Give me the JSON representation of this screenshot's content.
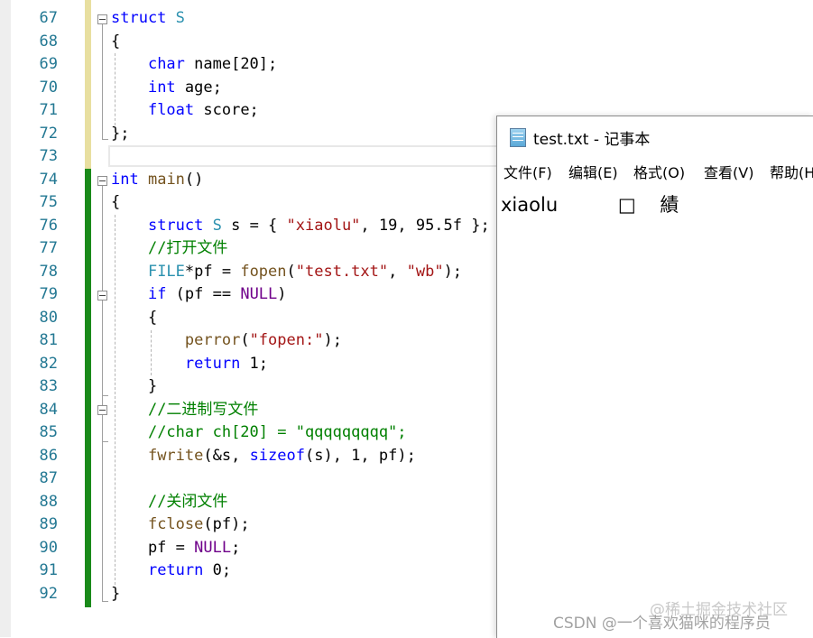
{
  "editor": {
    "line_numbers": [
      "67",
      "68",
      "69",
      "70",
      "71",
      "72",
      "73",
      "74",
      "75",
      "76",
      "77",
      "78",
      "79",
      "80",
      "81",
      "82",
      "83",
      "84",
      "85",
      "86",
      "87",
      "88",
      "89",
      "90",
      "91",
      "92"
    ],
    "lines": [
      [
        {
          "t": "struct",
          "c": "kw"
        },
        {
          "t": " "
        },
        {
          "t": "S",
          "c": "ty"
        }
      ],
      [
        {
          "t": "{"
        }
      ],
      [
        {
          "t": "    "
        },
        {
          "t": "char",
          "c": "kw"
        },
        {
          "t": " name[20];"
        }
      ],
      [
        {
          "t": "    "
        },
        {
          "t": "int",
          "c": "kw"
        },
        {
          "t": " age;"
        }
      ],
      [
        {
          "t": "    "
        },
        {
          "t": "float",
          "c": "kw"
        },
        {
          "t": " score;"
        }
      ],
      [
        {
          "t": "};"
        }
      ],
      [
        {
          "t": ""
        }
      ],
      [
        {
          "t": "int",
          "c": "kw"
        },
        {
          "t": " "
        },
        {
          "t": "main",
          "c": "fn"
        },
        {
          "t": "()"
        }
      ],
      [
        {
          "t": "{"
        }
      ],
      [
        {
          "t": "    "
        },
        {
          "t": "struct",
          "c": "kw"
        },
        {
          "t": " "
        },
        {
          "t": "S",
          "c": "ty"
        },
        {
          "t": " s = { "
        },
        {
          "t": "\"xiaolu\"",
          "c": "str"
        },
        {
          "t": ", 19, 95.5f };"
        }
      ],
      [
        {
          "t": "    "
        },
        {
          "t": "//打开文件",
          "c": "cm"
        }
      ],
      [
        {
          "t": "    "
        },
        {
          "t": "FILE",
          "c": "ty"
        },
        {
          "t": "*pf = "
        },
        {
          "t": "fopen",
          "c": "fn"
        },
        {
          "t": "("
        },
        {
          "t": "\"test.txt\"",
          "c": "str"
        },
        {
          "t": ", "
        },
        {
          "t": "\"wb\"",
          "c": "str"
        },
        {
          "t": ");"
        }
      ],
      [
        {
          "t": "    "
        },
        {
          "t": "if",
          "c": "kw"
        },
        {
          "t": " (pf == "
        },
        {
          "t": "NULL",
          "c": "mac"
        },
        {
          "t": ")"
        }
      ],
      [
        {
          "t": "    {"
        }
      ],
      [
        {
          "t": "        "
        },
        {
          "t": "perror",
          "c": "fn"
        },
        {
          "t": "("
        },
        {
          "t": "\"fopen:\"",
          "c": "str"
        },
        {
          "t": ");"
        }
      ],
      [
        {
          "t": "        "
        },
        {
          "t": "return",
          "c": "kw"
        },
        {
          "t": " 1;"
        }
      ],
      [
        {
          "t": "    }"
        }
      ],
      [
        {
          "t": "    "
        },
        {
          "t": "//二进制写文件",
          "c": "cm"
        }
      ],
      [
        {
          "t": "    "
        },
        {
          "t": "//char ch[20] = \"qqqqqqqqq\";",
          "c": "cm"
        }
      ],
      [
        {
          "t": "    "
        },
        {
          "t": "fwrite",
          "c": "fn"
        },
        {
          "t": "(&s, "
        },
        {
          "t": "sizeof",
          "c": "kw"
        },
        {
          "t": "(s), 1, pf);"
        }
      ],
      [
        {
          "t": ""
        }
      ],
      [
        {
          "t": "    "
        },
        {
          "t": "//关闭文件",
          "c": "cm"
        }
      ],
      [
        {
          "t": "    "
        },
        {
          "t": "fclose",
          "c": "fn"
        },
        {
          "t": "(pf);"
        }
      ],
      [
        {
          "t": "    pf = "
        },
        {
          "t": "NULL",
          "c": "mac"
        },
        {
          "t": ";"
        }
      ],
      [
        {
          "t": "    "
        },
        {
          "t": "return",
          "c": "kw"
        },
        {
          "t": " 0;"
        }
      ],
      [
        {
          "t": "}"
        }
      ]
    ]
  },
  "notepad": {
    "title": "test.txt - 记事本",
    "menu": [
      "文件(F)",
      "编辑(E)",
      "格式(O)",
      "查看(V)",
      "帮助(H)"
    ],
    "content": "xiaolu          □    績"
  },
  "watermark": {
    "csdn": "CSDN @一个喜欢猫咪的程序员",
    "juejin": "@稀土掘金技术社区"
  }
}
